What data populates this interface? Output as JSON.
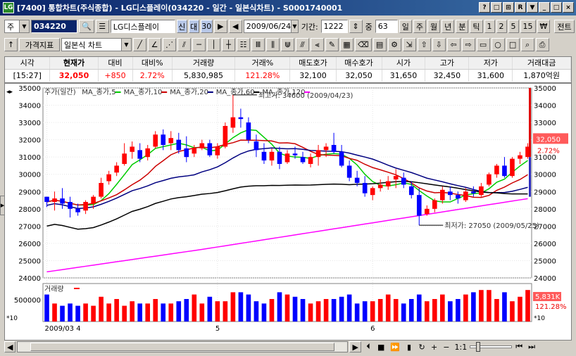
{
  "window": {
    "title": "[7400] 통합차트(주식종합) - LG디스플레이(034220 - 일간 - 일본식차트) - S0001740001",
    "icon": "LG",
    "buttons": [
      "?",
      "□",
      "⊞",
      "R",
      "▼",
      "_",
      "□",
      "×"
    ]
  },
  "toolbar1": {
    "market": "주",
    "code": "034220",
    "name": "LG디스플레이",
    "badge1": "신",
    "badge2": "대",
    "badge3": "30",
    "date": "2009/06/24",
    "period_label": "기간:",
    "period_value": "1222",
    "count_label": "중",
    "count_value": "63",
    "intervals": [
      "일",
      "주",
      "월",
      "년",
      "분",
      "틱",
      "1",
      "2",
      "5",
      "15",
      "₩"
    ],
    "right_label": "전트"
  },
  "toolbar2": {
    "indicator_btn": "가격지표",
    "chart_type": "일본식 차트"
  },
  "quote": {
    "headers": [
      "시각",
      "현재가",
      "대비",
      "대비%",
      "거래량",
      "거래%",
      "매도호가",
      "매수호가",
      "시가",
      "고가",
      "저가",
      "거래대금"
    ],
    "values": [
      "[15:27]",
      "32,050",
      "+850",
      "2.72%",
      "5,830,985",
      "121.28%",
      "32,100",
      "32,050",
      "31,650",
      "32,450",
      "31,600",
      "1,870억원"
    ]
  },
  "legend": {
    "price": "주가(일간)",
    "ma5": "MA_종가,5",
    "ma10": "MA_종가,10",
    "ma20": "MA_종가,20",
    "ma60": "MA_종가,60",
    "ma120": "MA_종가,120"
  },
  "annotations": {
    "high": "최고가: 34600 (2009/04/23)",
    "low": "최저가: 27050 (2009/05/25)"
  },
  "right_price_tag": "32,050",
  "right_pct_tag": "2.72%",
  "volume": {
    "label": "거래량",
    "unit": "*10",
    "tick": "500000",
    "last": "5,831K",
    "last_pct": "121.28%"
  },
  "x_axis": {
    "labels": [
      "2009/03 4",
      "5",
      "6"
    ]
  },
  "bottom": {
    "zoom": "1:1"
  },
  "colors": {
    "up": "#ff0000",
    "down": "#0000ff",
    "ma5": "#00cc00",
    "ma10": "#0000ff",
    "ma20": "#cc0000",
    "ma60": "#000080",
    "ma120": "#000000",
    "ma_long": "#ff00ff"
  },
  "chart_data": {
    "type": "candlestick",
    "ylim": [
      24000,
      35000
    ],
    "yticks": [
      24000,
      25000,
      26000,
      27000,
      28000,
      29000,
      30000,
      31000,
      32000,
      33000,
      34000,
      35000
    ],
    "ohlc": [
      [
        28700,
        28700,
        28100,
        28400
      ],
      [
        28400,
        29000,
        27900,
        28600
      ],
      [
        28600,
        29200,
        28000,
        28300
      ],
      [
        28400,
        28700,
        27500,
        28000
      ],
      [
        28000,
        28300,
        27600,
        27800
      ],
      [
        27900,
        28500,
        27700,
        28400
      ],
      [
        28300,
        28800,
        28000,
        28700
      ],
      [
        28700,
        29800,
        28600,
        29500
      ],
      [
        29600,
        30200,
        29400,
        30000
      ],
      [
        30100,
        30700,
        29900,
        30500
      ],
      [
        30600,
        31800,
        30500,
        31200
      ],
      [
        31300,
        31900,
        30900,
        31600
      ],
      [
        31400,
        31800,
        30700,
        30900
      ],
      [
        31000,
        31700,
        30800,
        31500
      ],
      [
        31600,
        32500,
        31500,
        32300
      ],
      [
        32300,
        32600,
        31400,
        31700
      ],
      [
        31800,
        32500,
        31400,
        32100
      ],
      [
        32000,
        32400,
        31200,
        31400
      ],
      [
        31500,
        32200,
        30700,
        31000
      ],
      [
        31200,
        31700,
        31000,
        31500
      ],
      [
        31500,
        32000,
        31400,
        31800
      ],
      [
        31800,
        32000,
        31000,
        31100
      ],
      [
        31100,
        31800,
        30900,
        31600
      ],
      [
        31600,
        33000,
        31500,
        32800
      ],
      [
        32700,
        34600,
        32400,
        33300
      ],
      [
        33300,
        33800,
        32700,
        33200
      ],
      [
        33000,
        33300,
        31800,
        32000
      ],
      [
        31900,
        32300,
        31000,
        31400
      ],
      [
        31300,
        31800,
        30600,
        30800
      ],
      [
        30800,
        31500,
        30500,
        31300
      ],
      [
        31300,
        31600,
        30300,
        30600
      ],
      [
        30700,
        31400,
        30600,
        31200
      ],
      [
        31200,
        31600,
        30900,
        31100
      ],
      [
        31000,
        31300,
        30600,
        30700
      ],
      [
        30600,
        31200,
        30400,
        31000
      ],
      [
        31000,
        31700,
        30500,
        31400
      ],
      [
        31400,
        31800,
        31000,
        31600
      ],
      [
        31700,
        32400,
        31200,
        31300
      ],
      [
        31300,
        31700,
        30400,
        30500
      ],
      [
        30500,
        30800,
        29600,
        29800
      ],
      [
        29800,
        30200,
        29300,
        29500
      ],
      [
        29500,
        29900,
        28700,
        28900
      ],
      [
        28800,
        29300,
        28500,
        29200
      ],
      [
        29200,
        29700,
        29000,
        29400
      ],
      [
        29300,
        29900,
        29100,
        29600
      ],
      [
        29700,
        30300,
        29200,
        29900
      ],
      [
        29800,
        30100,
        29200,
        29400
      ],
      [
        29300,
        29600,
        28600,
        28800
      ],
      [
        28800,
        29200,
        27050,
        27600
      ],
      [
        27700,
        28200,
        27600,
        28000
      ],
      [
        28000,
        28600,
        27800,
        28500
      ],
      [
        28500,
        29300,
        28300,
        29100
      ],
      [
        29000,
        29300,
        28500,
        28800
      ],
      [
        28800,
        29000,
        28300,
        28600
      ],
      [
        28500,
        29200,
        28400,
        29000
      ],
      [
        29000,
        29300,
        28700,
        28900
      ],
      [
        28800,
        29500,
        28700,
        29300
      ],
      [
        29400,
        30100,
        29300,
        30000
      ],
      [
        30000,
        30600,
        29800,
        30500
      ],
      [
        30500,
        31000,
        29800,
        29900
      ],
      [
        29900,
        31000,
        29800,
        30900
      ],
      [
        30900,
        31300,
        30600,
        31100
      ],
      [
        31000,
        31800,
        30900,
        31600
      ]
    ],
    "volume": [
      6,
      4,
      3.5,
      4,
      3.5,
      4,
      3.5,
      5.5,
      4,
      5,
      3.5,
      4.5,
      4,
      4,
      5,
      4,
      4,
      4.5,
      5,
      6,
      4,
      5.5,
      4.5,
      4.5,
      6.5,
      6.5,
      6,
      4.5,
      4,
      5,
      6.5,
      6,
      5.5,
      5,
      4,
      4.5,
      5,
      5,
      5.5,
      6,
      4,
      4.5,
      4.5,
      5,
      6,
      5,
      4,
      5,
      6,
      4.5,
      5,
      6,
      4.5,
      5,
      6,
      6.5,
      7,
      7,
      5,
      6.5,
      4.5,
      5.5,
      7
    ]
  }
}
